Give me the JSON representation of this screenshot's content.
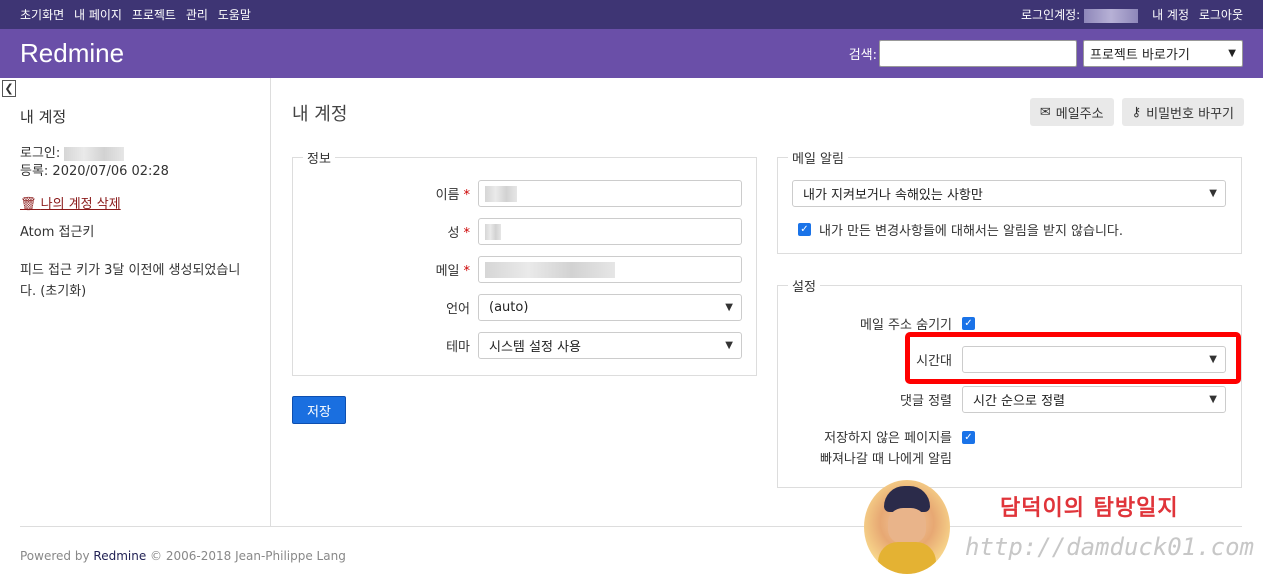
{
  "top_menu": {
    "items": [
      "초기화면",
      "내 페이지",
      "프로젝트",
      "관리",
      "도움말"
    ],
    "login_label": "로그인계정:",
    "my_account": "내 계정",
    "logout": "로그아웃"
  },
  "header": {
    "title": "Redmine",
    "search_label": "검색:",
    "search_value": "",
    "jump_label": "프로젝트 바로가기"
  },
  "sidebar": {
    "title": "내 계정",
    "login_label": "로그인:",
    "registered": "등록: 2020/07/06 02:28",
    "delete_label": "나의 계정 삭제",
    "atom_label": "Atom 접근키",
    "feed_note": "피드 접근 키가 3달 이전에 생성되었습니다. (초기화)"
  },
  "content": {
    "title": "내 계정",
    "email_button": "메일주소",
    "password_button": "비밀번호 바꾸기",
    "info": {
      "legend": "정보",
      "name_label": "이름",
      "lastname_label": "성",
      "mail_label": "메일",
      "language_label": "언어",
      "language_value": "(auto)",
      "theme_label": "테마",
      "theme_value": "시스템 설정 사용",
      "required": "*"
    },
    "save_label": "저장",
    "notifications": {
      "legend": "메일 알림",
      "select_value": "내가 지켜보거나 속해있는 사항만",
      "no_self_label": "내가 만든 변경사항들에 대해서는 알림을 받지 않습니다."
    },
    "preferences": {
      "legend": "설정",
      "hide_mail_label": "메일 주소 숨기기",
      "timezone_label": "시간대",
      "timezone_value": "",
      "comments_order_label": "댓글 정렬",
      "comments_order_value": "시간 순으로 정렬",
      "warn_unsaved_line1": "저장하지 않은 페이지를",
      "warn_unsaved_line2": "빠져나갈 때 나에게 알림"
    }
  },
  "footer": {
    "powered_by": "Powered by",
    "redmine_link": "Redmine",
    "copyright": "© 2006-2018 Jean-Philippe Lang"
  },
  "watermark": {
    "title": "담덕이의 탐방일지",
    "url": "http://damduck01.com"
  },
  "colors": {
    "top_bar": "#3e3574",
    "header": "#6a4fa8",
    "save_button": "#1a6fe0",
    "highlight": "#ff0000"
  }
}
